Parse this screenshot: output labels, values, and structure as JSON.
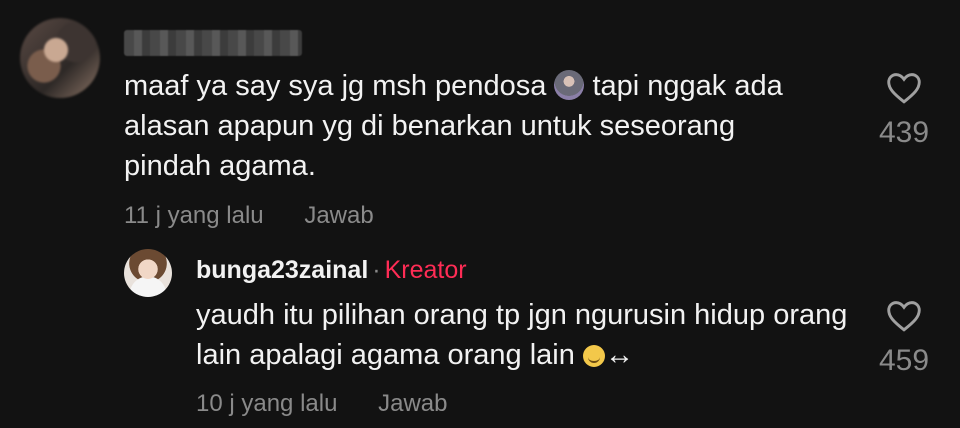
{
  "main_comment": {
    "text_part1": "maaf ya say sya jg msh pendosa ",
    "emoji_icon": "see-no-evil-monkey-icon",
    "text_part2": " tapi nggak ada alasan apapun yg di benarkan untuk seseorang pindah agama.",
    "time": "11 j yang lalu",
    "reply_label": "Jawab",
    "like_count": "439"
  },
  "reply_comment": {
    "username": "bunga23zainal",
    "separator": "·",
    "badge": "Kreator",
    "badge_color": "#fe2c55",
    "text": "yaudh itu pilihan orang tp jgn ngurusin hidup orang lain apalagi agama orang lain ",
    "emoji_icon": "smiling-face-icon",
    "trailing_symbol": "↔",
    "time": "10 j yang lalu",
    "reply_label": "Jawab",
    "like_count": "459"
  }
}
